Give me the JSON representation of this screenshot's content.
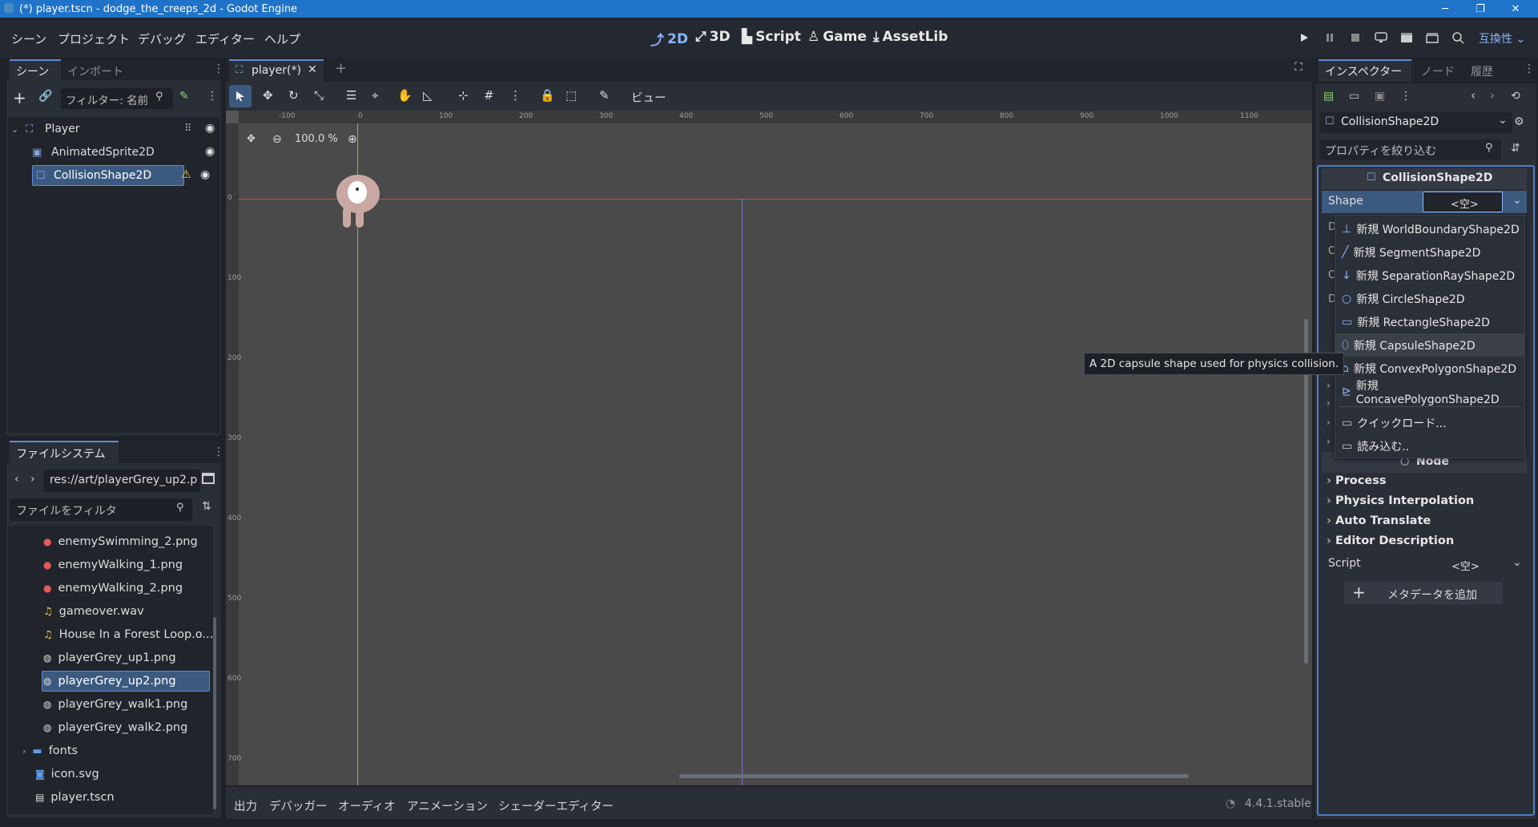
{
  "window": {
    "title": "(*) player.tscn - dodge_the_creeps_2d - Godot Engine"
  },
  "menu": [
    "シーン",
    "プロジェクト",
    "デバッグ",
    "エディター",
    "ヘルプ"
  ],
  "workspaces": [
    "2D",
    "3D",
    "Script",
    "Game",
    "AssetLib"
  ],
  "renderer": "互換性",
  "scene_dock": {
    "tabs": [
      "シーン",
      "インポート"
    ],
    "filter_placeholder": "フィルター: 名前",
    "nodes": [
      "Player",
      "AnimatedSprite2D",
      "CollisionShape2D"
    ]
  },
  "filesystem": {
    "tab": "ファイルシステム",
    "path": "res://art/playerGrey_up2.p",
    "filter_placeholder": "ファイルをフィルタ",
    "files": [
      "enemySwimming_2.png",
      "enemyWalking_1.png",
      "enemyWalking_2.png",
      "gameover.wav",
      "House In a Forest Loop.o...",
      "playerGrey_up1.png",
      "playerGrey_up2.png",
      "playerGrey_walk1.png",
      "playerGrey_walk2.png",
      "fonts",
      "icon.svg",
      "player.tscn"
    ]
  },
  "editor": {
    "scene_tab": "player(*)",
    "view_menu": "ビュー",
    "zoom": "100.0 %",
    "ruler_h": [
      "-100",
      "0",
      "100",
      "200",
      "300",
      "400",
      "500",
      "600",
      "700",
      "800",
      "900",
      "1000",
      "1100"
    ],
    "ruler_v": [
      "0",
      "100",
      "200",
      "300",
      "400",
      "500",
      "600",
      "700"
    ]
  },
  "bottom_panel": {
    "tabs": [
      "出力",
      "デバッガー",
      "オーディオ",
      "アニメーション",
      "シェーダーエディター"
    ],
    "version": "4.4.1.stable"
  },
  "inspector": {
    "tabs": [
      "インスペクター",
      "ノード",
      "履歴"
    ],
    "object": "CollisionShape2D",
    "filter_placeholder": "プロパティを絞り込む",
    "section_title": "CollisionShape2D",
    "shape_label": "Shape",
    "shape_value": "<空>",
    "node_section": "Node",
    "sections": [
      "Process",
      "Physics Interpolation",
      "Auto Translate",
      "Editor Description"
    ],
    "script_label": "Script",
    "script_value": "<空>",
    "add_metadata": "メタデータを追加"
  },
  "shape_menu": {
    "items": [
      "新規 WorldBoundaryShape2D",
      "新規 SegmentShape2D",
      "新規 SeparationRayShape2D",
      "新規 CircleShape2D",
      "新規 RectangleShape2D",
      "新規 CapsuleShape2D",
      "新規 ConvexPolygonShape2D",
      "新規 ConcavePolygonShape2D"
    ],
    "quick_load": "クイックロード...",
    "load": "読み込む..",
    "tooltip": "A 2D capsule shape used for physics collision."
  },
  "colors": {
    "accent": "#1f73c9",
    "selected": "#3c5a80",
    "warning": "#f2c744"
  }
}
